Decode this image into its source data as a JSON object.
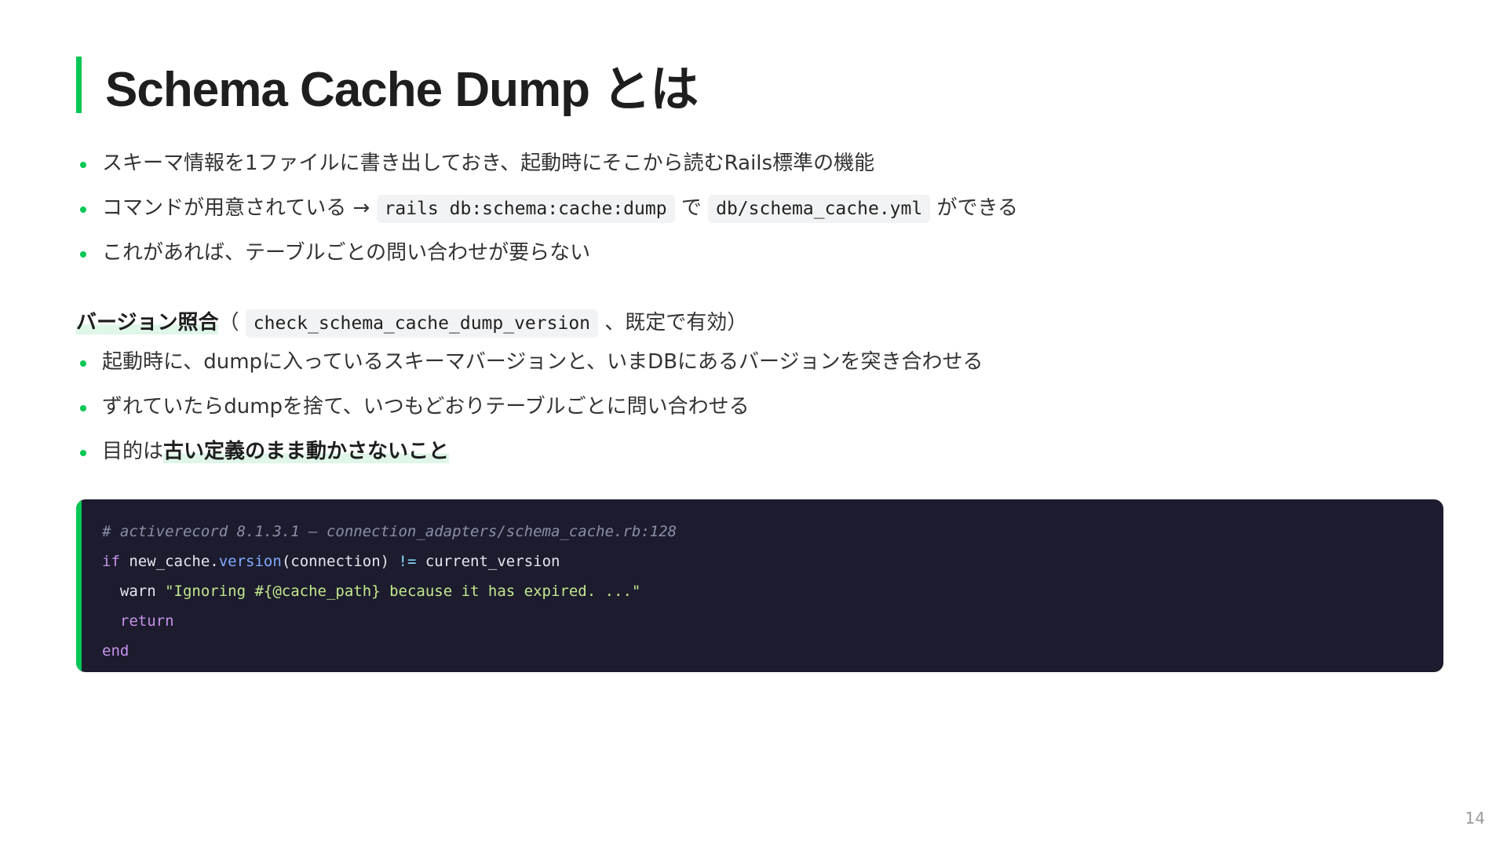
{
  "slide": {
    "title": "Schema Cache Dump とは",
    "page_number": "14",
    "accent_color": "#06c755"
  },
  "bullets_intro": [
    {
      "text": "スキーマ情報を1ファイルに書き出しておき、起動時にそこから読むRails標準の機能"
    },
    {
      "pre": "コマンドが用意されている → ",
      "code1": "rails db:schema:cache:dump",
      "mid": " で ",
      "code2": "db/schema_cache.yml",
      "post": " ができる"
    },
    {
      "text": "これがあれば、テーブルごとの問い合わせが要らない"
    }
  ],
  "version_section": {
    "heading": "バージョン照合",
    "open_paren": "（ ",
    "code": "check_schema_cache_dump_version",
    "rest": " 、既定で有効）"
  },
  "bullets_version": [
    {
      "text": "起動時に、dumpに入っているスキーマバージョンと、いまDBにあるバージョンを突き合わせる"
    },
    {
      "text": "ずれていたらdumpを捨て、いつもどおりテーブルごとに問い合わせる"
    },
    {
      "pre": "目的は",
      "emph": "古い定義のまま動かさないこと"
    }
  ],
  "code_block": {
    "comment": "# activerecord 8.1.3.1 — connection_adapters/schema_cache.rb:128",
    "line2": {
      "kw": "if",
      "a": " new_cache.",
      "fn": "version",
      "b": "(connection) ",
      "op": "!=",
      "c": " current_version"
    },
    "line3": {
      "indent": "  ",
      "a": "warn ",
      "str": "\"Ignoring #{@cache_path} because it has expired. ...\""
    },
    "line4": {
      "indent": "  ",
      "kw": "return"
    },
    "line5": {
      "kw": "end"
    }
  }
}
